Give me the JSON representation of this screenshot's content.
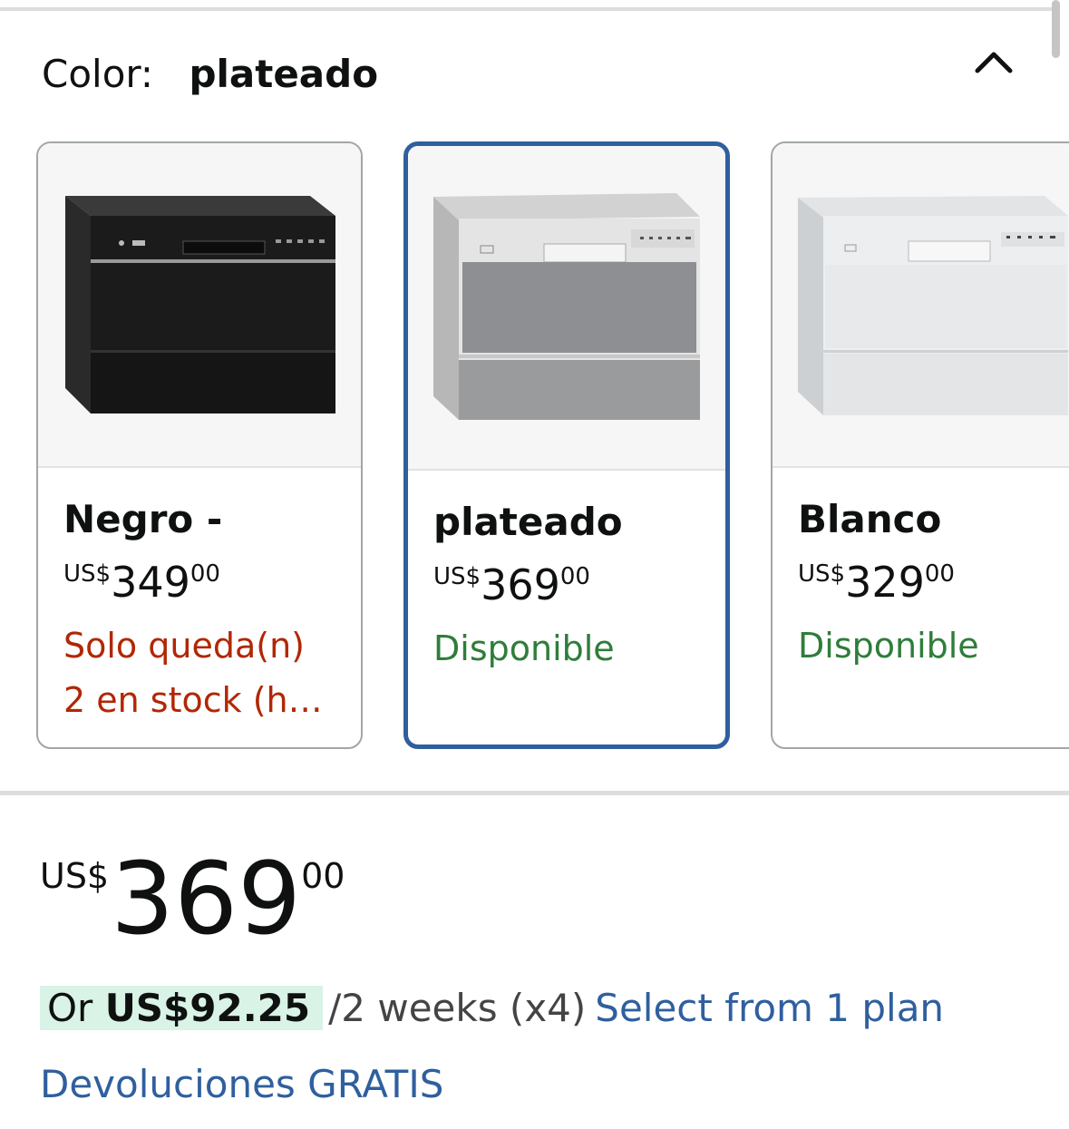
{
  "color_selector": {
    "label": "Color:",
    "selected_value": "plateado",
    "collapse_icon": "chevron-up-icon"
  },
  "options": [
    {
      "name": "Negro -",
      "price": {
        "currency": "US$",
        "whole": "349",
        "cents": "00"
      },
      "status": "Solo queda(n) 2 en stock (h…",
      "status_color": "#b12704",
      "appliance_color": "black"
    },
    {
      "name": "plateado",
      "price": {
        "currency": "US$",
        "whole": "369",
        "cents": "00"
      },
      "status": "Disponible",
      "status_color": "#2f7d3a",
      "appliance_color": "silver",
      "selected": true
    },
    {
      "name": "Blanco",
      "price": {
        "currency": "US$",
        "whole": "329",
        "cents": "00"
      },
      "status": "Disponible",
      "status_color": "#2f7d3a",
      "appliance_color": "white"
    }
  ],
  "price": {
    "currency": "US$",
    "whole": "369",
    "cents": "00"
  },
  "installments": {
    "prefix": "Or",
    "amount": "US$92.25",
    "interval": "/2 weeks (x4)",
    "link": "Select from 1 plan"
  },
  "returns": "Devoluciones GRATIS",
  "colors": {
    "selected_border": "#2f5f9e",
    "link": "#2f5f9e",
    "low_stock": "#b12704",
    "in_stock": "#2f7d3a",
    "installment_badge": "#d9f3e6"
  }
}
